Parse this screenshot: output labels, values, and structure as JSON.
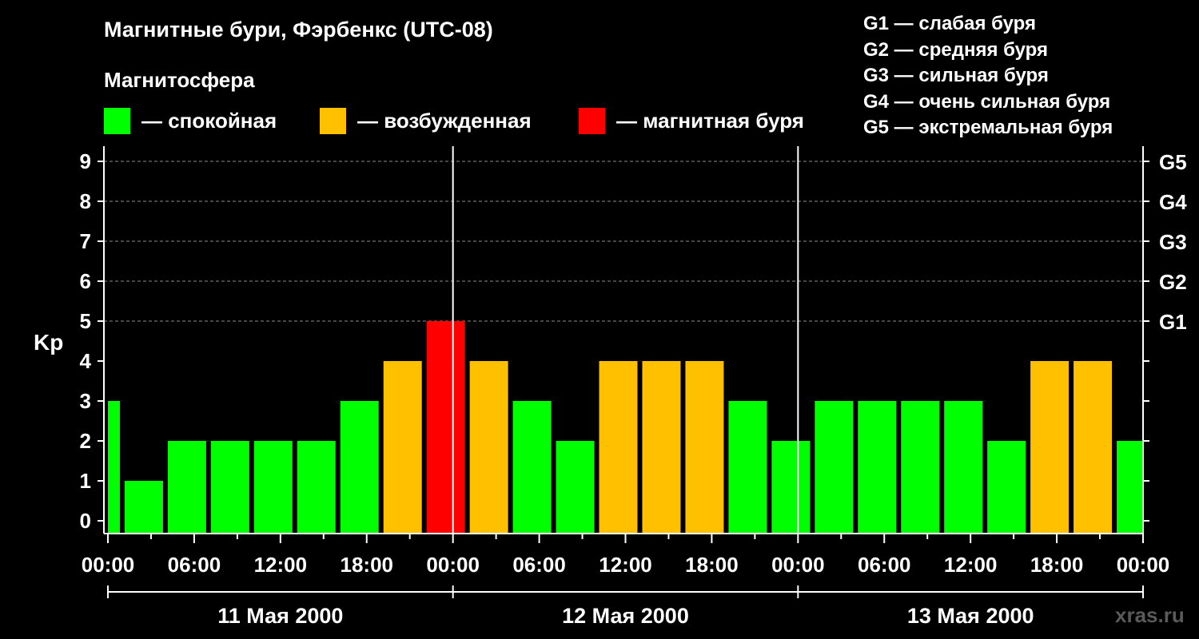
{
  "header": {
    "title": "Магнитные бури, Фэрбенкс (UTC-08)",
    "subtitle": "Магнитосфера"
  },
  "legend": {
    "items": [
      {
        "label": "— спокойная",
        "color": "#00ff00"
      },
      {
        "label": "— возбужденная",
        "color": "#ffc000"
      },
      {
        "label": "— магнитная буря",
        "color": "#ff0000"
      }
    ]
  },
  "g_legend": [
    "G1 — слабая буря",
    "G2 — средняя буря",
    "G3 — сильная буря",
    "G4 — очень сильная буря",
    "G5 — экстремальная буря"
  ],
  "watermark": "xras.ru",
  "colors": {
    "quiet": "#00ff00",
    "active": "#ffc000",
    "storm": "#ff0000",
    "background": "#000000",
    "grid": "#8c8c8c"
  },
  "chart_data": {
    "type": "bar",
    "ylabel": "Kp",
    "ylim": [
      0,
      9
    ],
    "yticks": [
      "0",
      "1",
      "2",
      "3",
      "4",
      "5",
      "6",
      "7",
      "8",
      "9"
    ],
    "right_axis_labels": [
      {
        "kp": 5,
        "label": "G1"
      },
      {
        "kp": 6,
        "label": "G2"
      },
      {
        "kp": 7,
        "label": "G3"
      },
      {
        "kp": 8,
        "label": "G4"
      },
      {
        "kp": 9,
        "label": "G5"
      }
    ],
    "grid": "horizontal dashed at Kp 5–9",
    "x_start_hour": 0,
    "x_end_hour": 72,
    "x_tick_labels": [
      "00:00",
      "06:00",
      "12:00",
      "18:00",
      "00:00",
      "06:00",
      "12:00",
      "18:00",
      "00:00",
      "06:00",
      "12:00",
      "18:00",
      "00:00"
    ],
    "x_tick_hours": [
      0,
      6,
      12,
      18,
      24,
      30,
      36,
      42,
      48,
      54,
      60,
      66,
      72
    ],
    "day_labels": [
      "11 Мая 2000",
      "12 Мая 2000",
      "13 Мая 2000"
    ],
    "day_divider_hours": [
      24,
      48
    ],
    "bars": [
      {
        "start": 0,
        "end": 1,
        "kp": 3,
        "level": "quiet"
      },
      {
        "start": 1,
        "end": 4,
        "kp": 1,
        "level": "quiet"
      },
      {
        "start": 4,
        "end": 7,
        "kp": 2,
        "level": "quiet"
      },
      {
        "start": 7,
        "end": 10,
        "kp": 2,
        "level": "quiet"
      },
      {
        "start": 10,
        "end": 13,
        "kp": 2,
        "level": "quiet"
      },
      {
        "start": 13,
        "end": 16,
        "kp": 2,
        "level": "quiet"
      },
      {
        "start": 16,
        "end": 19,
        "kp": 3,
        "level": "quiet"
      },
      {
        "start": 19,
        "end": 22,
        "kp": 4,
        "level": "active"
      },
      {
        "start": 22,
        "end": 25,
        "kp": 5,
        "level": "storm"
      },
      {
        "start": 25,
        "end": 28,
        "kp": 4,
        "level": "active"
      },
      {
        "start": 28,
        "end": 31,
        "kp": 3,
        "level": "quiet"
      },
      {
        "start": 31,
        "end": 34,
        "kp": 2,
        "level": "quiet"
      },
      {
        "start": 34,
        "end": 37,
        "kp": 4,
        "level": "active"
      },
      {
        "start": 37,
        "end": 40,
        "kp": 4,
        "level": "active"
      },
      {
        "start": 40,
        "end": 43,
        "kp": 4,
        "level": "active"
      },
      {
        "start": 43,
        "end": 46,
        "kp": 3,
        "level": "quiet"
      },
      {
        "start": 46,
        "end": 49,
        "kp": 2,
        "level": "quiet"
      },
      {
        "start": 49,
        "end": 52,
        "kp": 3,
        "level": "quiet"
      },
      {
        "start": 52,
        "end": 55,
        "kp": 3,
        "level": "quiet"
      },
      {
        "start": 55,
        "end": 58,
        "kp": 3,
        "level": "quiet"
      },
      {
        "start": 58,
        "end": 61,
        "kp": 3,
        "level": "quiet"
      },
      {
        "start": 61,
        "end": 64,
        "kp": 2,
        "level": "quiet"
      },
      {
        "start": 64,
        "end": 67,
        "kp": 4,
        "level": "active"
      },
      {
        "start": 67,
        "end": 70,
        "kp": 4,
        "level": "active"
      },
      {
        "start": 70,
        "end": 72,
        "kp": 2,
        "level": "quiet"
      }
    ]
  }
}
